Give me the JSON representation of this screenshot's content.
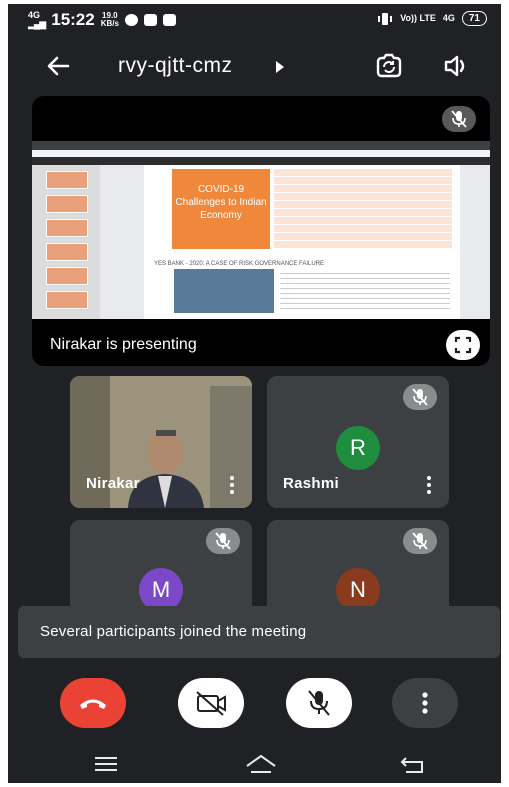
{
  "status_bar": {
    "network": "4G",
    "time": "15:22",
    "speed_value": "19.0",
    "speed_unit": "KB/s",
    "volte": "Vo)) LTE",
    "signal_right": "4G",
    "battery": "71"
  },
  "top_bar": {
    "meeting_code": "rvy-qjtt-cmz"
  },
  "presentation": {
    "label": "Nirakar is presenting",
    "slide_title": "COVID-19 Challenges to Indian Economy",
    "slide_subtitle": "YES BANK - 2020: A CASE OF RISK GOVERNANCE FAILURE"
  },
  "participants": [
    {
      "name": "Nirakar",
      "initial": "",
      "avatar_color": "",
      "video": true,
      "muted": false
    },
    {
      "name": "Rashmi",
      "initial": "R",
      "avatar_color": "#1e8e3e",
      "video": false,
      "muted": true
    },
    {
      "name": "",
      "initial": "M",
      "avatar_color": "#7b49c7",
      "video": false,
      "muted": true
    },
    {
      "name": "",
      "initial": "N",
      "avatar_color": "#8a3a1d",
      "video": false,
      "muted": true
    }
  ],
  "toast": {
    "message": "Several participants joined the meeting"
  },
  "colors": {
    "background": "#202124",
    "tile": "#3c4043",
    "end_call": "#ea4335"
  }
}
